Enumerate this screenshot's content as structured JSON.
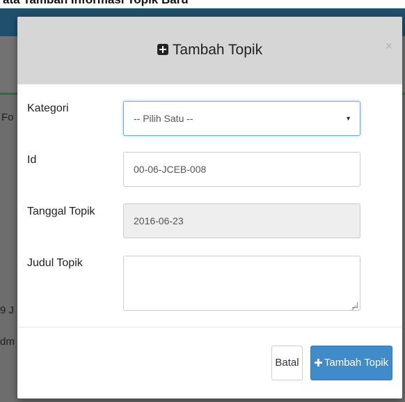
{
  "caption": "ata Tambah Informasi Topik Baru",
  "background_page": {
    "fragments": [
      "Fo",
      "9 J",
      "dm"
    ]
  },
  "modal": {
    "title_icon": "plus-square-icon",
    "title": "Tambah Topik",
    "close_label": "×",
    "fields": {
      "kategori": {
        "label": "Kategori",
        "value": "-- Pilih Satu --"
      },
      "id": {
        "label": "Id",
        "value": "00-06-JCEB-008"
      },
      "tanggal": {
        "label": "Tanggal Topik",
        "value": "2016-06-23"
      },
      "judul": {
        "label": "Judul Topik",
        "value": ""
      }
    },
    "buttons": {
      "cancel": "Batal",
      "submit": "Tambah Topik"
    }
  },
  "colors": {
    "primary": "#428bca",
    "header_bg": "#d6d6d6",
    "navbar": "#1f4f6b",
    "focus_border": "#66afe9"
  }
}
